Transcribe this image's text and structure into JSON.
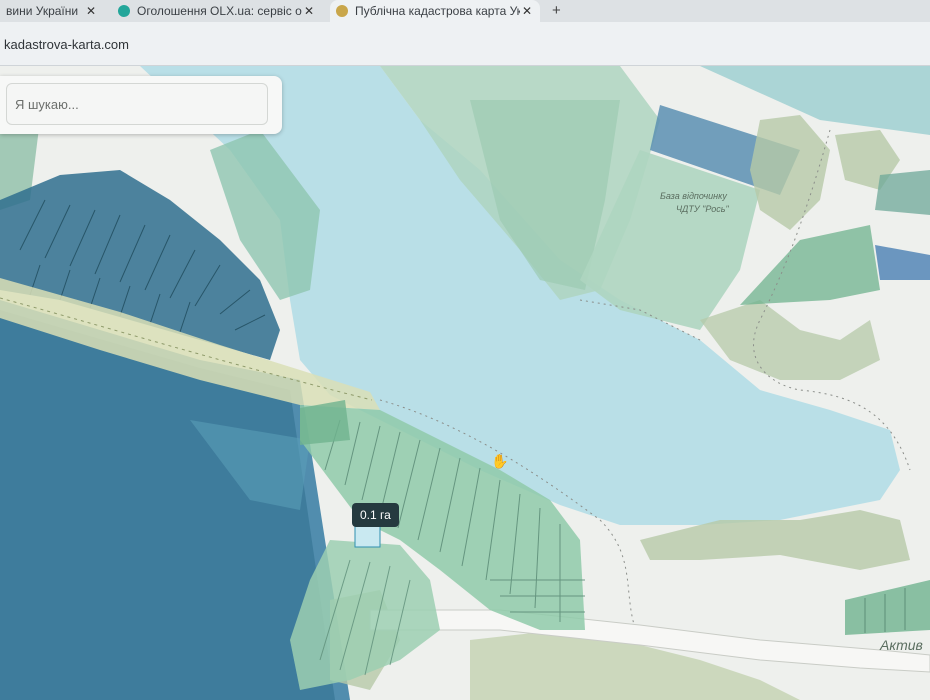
{
  "browser": {
    "tabs": [
      {
        "title": "вини України",
        "favicon_color": "#3f7d5b"
      },
      {
        "title": "Оголошення OLX.ua: сервіс оголошень",
        "favicon_color": "#23a69a"
      },
      {
        "title": "Публічна кадастрова карта України",
        "favicon_color": "#c9a64a"
      }
    ],
    "close_symbol": "✕",
    "new_tab_symbol": "+",
    "url": "kadastrova-karta.com"
  },
  "search": {
    "placeholder": "Я шукаю..."
  },
  "map": {
    "labels": {
      "recreation_base_line1": "База відпочинку",
      "recreation_base_line2": "ЧДТУ \"Рось\"",
      "bottom_right_partial": "Актив"
    },
    "area_badge": "0.1 га",
    "colors": {
      "water": "#b9dfe7",
      "ground": "#eef0ed",
      "parcel": "#aed5c0",
      "parcel_dark": "#4f9b8d",
      "parcel_blue": "#3f82a6",
      "forest": "#b6c9a8",
      "road": "#d9dfb6"
    }
  }
}
